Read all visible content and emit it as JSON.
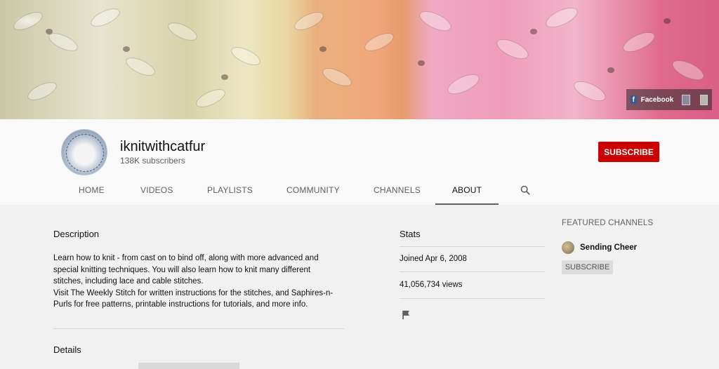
{
  "banner": {
    "social_link_label": "Facebook"
  },
  "channel": {
    "name": "iknitwithcatfur",
    "subscribers": "138K subscribers",
    "subscribe_label": "SUBSCRIBE"
  },
  "tabs": [
    {
      "label": "HOME"
    },
    {
      "label": "VIDEOS"
    },
    {
      "label": "PLAYLISTS"
    },
    {
      "label": "COMMUNITY"
    },
    {
      "label": "CHANNELS"
    },
    {
      "label": "ABOUT"
    }
  ],
  "about": {
    "description_title": "Description",
    "description_text": "Learn how to knit - from cast on to bind off, along with more advanced and\nspecial knitting techniques.  You will also learn how to knit many different\nstitches, including lace and cable stitches.\nVisit The Weekly Stitch for written instructions for the stitches, and Saphires-n-\nPurls for  free patterns, printable instructions for tutorials, and more info.",
    "details_title": "Details"
  },
  "stats": {
    "title": "Stats",
    "joined": "Joined Apr 6, 2008",
    "views": "41,056,734 views"
  },
  "featured": {
    "title": "FEATURED CHANNELS",
    "channel_name": "Sending Cheer",
    "subscribe_label": "SUBSCRIBE"
  },
  "colors": {
    "subscribe_red": "#cc0000",
    "active_tab_underline": "#606060"
  }
}
